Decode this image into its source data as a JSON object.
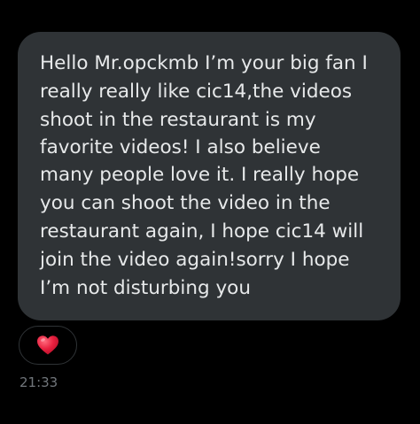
{
  "message": {
    "lines": [
      "Hello Mr.opckmb I’m your big fan I",
      "really really like cic14,the videos",
      "shoot in the restaurant is my",
      "favorite videos! I also believe",
      "many people love it. I really hope",
      "you can shoot the video in the",
      "restaurant again, I hope cic14 will",
      "join the video again!sorry I hope",
      "I’m not disturbing you"
    ],
    "timestamp": "21:33"
  },
  "reaction": {
    "icon": "red-heart-icon",
    "color": "#e0245e"
  },
  "colors": {
    "background": "#000000",
    "bubble": "#2f3336",
    "text": "#e7e9ea",
    "muted": "#71767b"
  }
}
